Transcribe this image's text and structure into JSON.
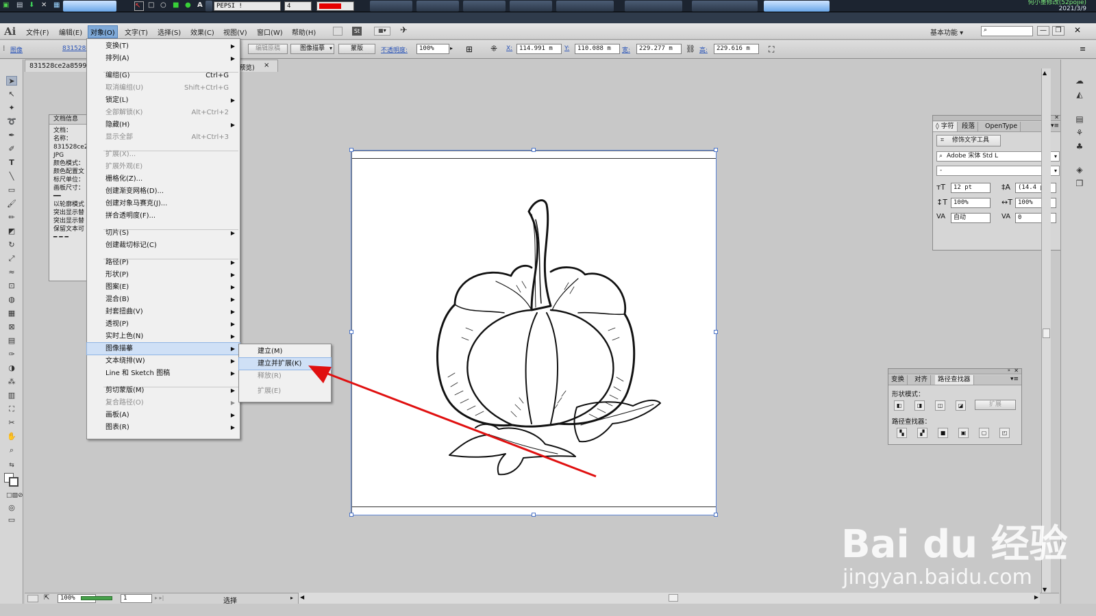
{
  "taskbar": {
    "brand_field": "PEPSI !",
    "stroke_field": "4",
    "swatch_color": "#e60000",
    "tray_line1": "何小墨修改(52pojie)",
    "tray_line2": "2021/3/9"
  },
  "app": {
    "logo": "Ai"
  },
  "menubar": {
    "items": [
      "文件(F)",
      "编辑(E)",
      "对象(O)",
      "文字(T)",
      "选择(S)",
      "效果(C)",
      "视图(V)",
      "窗口(W)",
      "帮助(H)"
    ],
    "st_badge": "St",
    "workspace": "基本功能",
    "search_placeholder": ""
  },
  "controlbar": {
    "label_image": "图像",
    "link_file": "831528c",
    "btn_embed": "编辑原稿",
    "btn_trace": "图像描摹",
    "btn_mask": "蒙版",
    "opacity_label": "不透明度:",
    "opacity_value": "100%",
    "x_label": "X:",
    "x_value": "114.991 m",
    "y_label": "Y:",
    "y_value": "110.088 m",
    "w_label": "宽:",
    "w_value": "229.277 m",
    "h_label": "高:",
    "h_value": "229.616 m"
  },
  "document": {
    "tab_title": "831528ce2a8599",
    "tab_suffix": "预览)",
    "close_glyph": "×"
  },
  "doc_info_panel": {
    "title": "文档信息",
    "lines": [
      "文档：",
      "",
      "名称：",
      "831528ce2",
      "JPG",
      "",
      "颜色模式：",
      "颜色配置文",
      "标尺单位：",
      "画板尺寸：",
      "━━",
      "以轮廓模式",
      "突出显示替",
      "突出显示替",
      "保留文本可",
      "━ ━ ━"
    ]
  },
  "object_menu": {
    "items": [
      {
        "label": "变换(T)",
        "shortcut": "",
        "submenu": true,
        "disabled": false
      },
      {
        "label": "排列(A)",
        "shortcut": "",
        "submenu": true,
        "disabled": false
      },
      {
        "label": "编组(G)",
        "shortcut": "Ctrl+G",
        "submenu": false,
        "disabled": false
      },
      {
        "label": "取消编组(U)",
        "shortcut": "Shift+Ctrl+G",
        "submenu": false,
        "disabled": true
      },
      {
        "label": "锁定(L)",
        "shortcut": "",
        "submenu": true,
        "disabled": false
      },
      {
        "label": "全部解锁(K)",
        "shortcut": "Alt+Ctrl+2",
        "submenu": false,
        "disabled": true
      },
      {
        "label": "隐藏(H)",
        "shortcut": "",
        "submenu": true,
        "disabled": false
      },
      {
        "label": "显示全部",
        "shortcut": "Alt+Ctrl+3",
        "submenu": false,
        "disabled": true
      },
      {
        "label": "扩展(X)...",
        "shortcut": "",
        "submenu": false,
        "disabled": true
      },
      {
        "label": "扩展外观(E)",
        "shortcut": "",
        "submenu": false,
        "disabled": true
      },
      {
        "label": "栅格化(Z)...",
        "shortcut": "",
        "submenu": false,
        "disabled": false
      },
      {
        "label": "创建渐变网格(D)...",
        "shortcut": "",
        "submenu": false,
        "disabled": false
      },
      {
        "label": "创建对象马赛克(J)...",
        "shortcut": "",
        "submenu": false,
        "disabled": false
      },
      {
        "label": "拼合透明度(F)...",
        "shortcut": "",
        "submenu": false,
        "disabled": false
      },
      {
        "label": "切片(S)",
        "shortcut": "",
        "submenu": true,
        "disabled": false
      },
      {
        "label": "创建裁切标记(C)",
        "shortcut": "",
        "submenu": false,
        "disabled": false
      },
      {
        "label": "路径(P)",
        "shortcut": "",
        "submenu": true,
        "disabled": false
      },
      {
        "label": "形状(P)",
        "shortcut": "",
        "submenu": true,
        "disabled": false
      },
      {
        "label": "图案(E)",
        "shortcut": "",
        "submenu": true,
        "disabled": false
      },
      {
        "label": "混合(B)",
        "shortcut": "",
        "submenu": true,
        "disabled": false
      },
      {
        "label": "封套扭曲(V)",
        "shortcut": "",
        "submenu": true,
        "disabled": false
      },
      {
        "label": "透视(P)",
        "shortcut": "",
        "submenu": true,
        "disabled": false
      },
      {
        "label": "实时上色(N)",
        "shortcut": "",
        "submenu": true,
        "disabled": false
      },
      {
        "label": "图像描摹",
        "shortcut": "",
        "submenu": true,
        "disabled": false,
        "highlight": true
      },
      {
        "label": "文本绕排(W)",
        "shortcut": "",
        "submenu": true,
        "disabled": false
      },
      {
        "label": "Line 和 Sketch 图稿",
        "shortcut": "",
        "submenu": true,
        "disabled": false
      },
      {
        "label": "剪切蒙版(M)",
        "shortcut": "",
        "submenu": true,
        "disabled": false
      },
      {
        "label": "复合路径(O)",
        "shortcut": "",
        "submenu": true,
        "disabled": true
      },
      {
        "label": "画板(A)",
        "shortcut": "",
        "submenu": true,
        "disabled": false
      },
      {
        "label": "图表(R)",
        "shortcut": "",
        "submenu": true,
        "disabled": false
      }
    ]
  },
  "trace_submenu": {
    "items": [
      {
        "label": "建立(M)",
        "disabled": false
      },
      {
        "label": "建立并扩展(K)",
        "disabled": false,
        "highlight": true
      },
      {
        "label": "释放(R)",
        "disabled": true
      },
      {
        "label": "扩展(E)",
        "disabled": true
      }
    ]
  },
  "character_panel": {
    "tabs": [
      "◊ 字符",
      "段落",
      "OpenType"
    ],
    "touch_tool": "修饰文字工具",
    "font_family": "Adobe 宋体 Std L",
    "font_style": "-",
    "size": "12 pt",
    "leading": "(14.4 p",
    "vscale": "100%",
    "hscale": "100%",
    "kerning": "自动",
    "tracking": "0"
  },
  "pathfinder_panel": {
    "tabs": [
      "变换",
      "对齐",
      "路径查找器"
    ],
    "shape_modes_label": "形状模式：",
    "expand_button": "扩展",
    "pathfinders_label": "路径查找器："
  },
  "statusbar": {
    "zoom": "100%",
    "artboard": "1",
    "tool_status": "选择"
  },
  "watermark": {
    "brand": "Bai du 经验",
    "url": "jingyan.baidu.com"
  },
  "colors": {
    "arrow": "#e01010",
    "selection": "#5b84d6",
    "menu_highlight": "#cfe0f6"
  }
}
